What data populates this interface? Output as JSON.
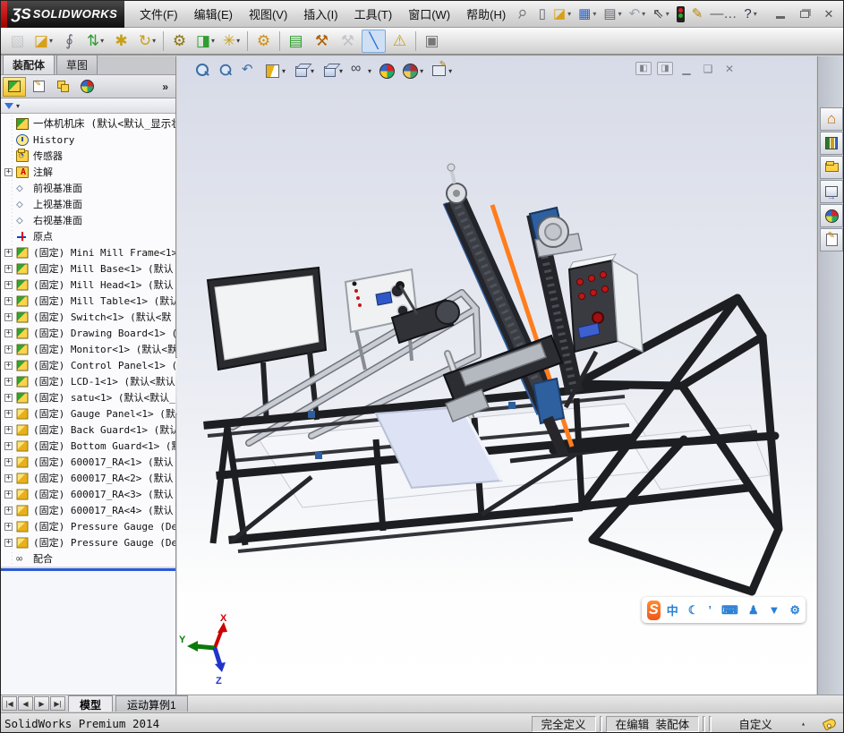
{
  "titlebar": {
    "logo_mark": "ƷS",
    "logo_text": "SOLIDWORKS",
    "menus": [
      {
        "label": "文件(F)"
      },
      {
        "label": "编辑(E)"
      },
      {
        "label": "视图(V)"
      },
      {
        "label": "插入(I)"
      },
      {
        "label": "工具(T)"
      },
      {
        "label": "窗口(W)"
      },
      {
        "label": "帮助(H)"
      }
    ],
    "quick_icons": [
      {
        "name": "new-document-button",
        "glyph": "▯",
        "color": "#5a6675"
      },
      {
        "name": "open-button",
        "glyph": "◪",
        "color": "#d8a01a",
        "caret": true
      },
      {
        "name": "save-button",
        "glyph": "▦",
        "color": "#2a62c8",
        "caret": true
      },
      {
        "name": "print-button",
        "glyph": "▤",
        "color": "#666670",
        "caret": true
      },
      {
        "name": "undo-button",
        "glyph": "↶",
        "color": "#9aa0aa",
        "caret": true
      },
      {
        "name": "select-button",
        "glyph": "⇖",
        "color": "#333",
        "caret": true
      },
      {
        "name": "rebuild-button",
        "glyph": "",
        "color": "#222"
      },
      {
        "name": "file-properties-button",
        "glyph": "✎",
        "color": "#b58400"
      },
      {
        "name": "options-button",
        "glyph": "—…",
        "color": "#555"
      },
      {
        "name": "help-button",
        "glyph": "?",
        "color": "#334",
        "caret": true
      }
    ]
  },
  "main_toolbar": {
    "items": [
      {
        "name": "insert-component-button",
        "glyph": "▧",
        "color": "#a7acb2",
        "disabled": true
      },
      {
        "name": "open-part-button",
        "glyph": "◪",
        "color": "#d8a01a",
        "caret": true
      },
      {
        "name": "mate-button",
        "glyph": "∮",
        "color": "#667"
      },
      {
        "name": "move-component-button",
        "glyph": "⇅",
        "color": "#2f9e2f",
        "caret": true
      },
      {
        "name": "smart-fasteners-button",
        "glyph": "✱",
        "color": "#c8a018"
      },
      {
        "name": "rotate-component-button",
        "glyph": "↻",
        "color": "#c8a018",
        "caret": true
      },
      {
        "name": "sep",
        "sep": true
      },
      {
        "name": "assembly-features-button",
        "glyph": "⚙",
        "color": "#8a7410"
      },
      {
        "name": "new-part-button",
        "glyph": "◨",
        "color": "#2f9e2f",
        "caret": true
      },
      {
        "name": "reference-geometry-button",
        "glyph": "✳",
        "color": "#c8a018",
        "caret": true
      },
      {
        "name": "sep",
        "sep": true
      },
      {
        "name": "motion-study-button",
        "glyph": "⚙",
        "color": "#d08f10"
      },
      {
        "name": "sep",
        "sep": true
      },
      {
        "name": "exploded-view-button",
        "glyph": "▤",
        "color": "#2f9e2f"
      },
      {
        "name": "interference-detection-button",
        "glyph": "⚒",
        "color": "#b06000"
      },
      {
        "name": "unavailable-tool-button",
        "glyph": "⚒",
        "color": "#99a",
        "disabled": true
      },
      {
        "name": "instant3d-button",
        "glyph": "╲",
        "color": "#2a6fd0",
        "selected": true
      },
      {
        "name": "large-assembly-mode-button",
        "glyph": "⚠",
        "color": "#c8a018"
      },
      {
        "name": "sep",
        "sep": true
      },
      {
        "name": "appearance-pattern-button",
        "glyph": "▣",
        "color": "#777"
      }
    ]
  },
  "left_panel": {
    "tabs": [
      {
        "label": "装配体",
        "active": true
      },
      {
        "label": "草图"
      }
    ],
    "pane_buttons": [
      {
        "name": "featuremanager-tree-tab",
        "icon": "cube",
        "active": true
      },
      {
        "name": "propertymanager-tab",
        "icon": "sheet"
      },
      {
        "name": "configurationmanager-tab",
        "icon": "cfg"
      },
      {
        "name": "appearances-tab",
        "icon": "ball"
      }
    ],
    "overflow_chevron": "»",
    "tree": [
      {
        "label": "一体机机床 (默认<默认_显示状",
        "icon": "assembly",
        "root": true
      },
      {
        "label": "History",
        "icon": "history"
      },
      {
        "label": "传感器",
        "icon": "sensors"
      },
      {
        "label": "注解",
        "icon": "annotations",
        "expand": true
      },
      {
        "label": "前视基准面",
        "icon": "plane"
      },
      {
        "label": "上视基准面",
        "icon": "plane"
      },
      {
        "label": "右视基准面",
        "icon": "plane"
      },
      {
        "label": "原点",
        "icon": "origin"
      },
      {
        "label": "(固定) Mini Mill Frame<1>",
        "icon": "part-green",
        "expand": true
      },
      {
        "label": "(固定) Mill Base<1> (默认",
        "icon": "part-green",
        "expand": true
      },
      {
        "label": "(固定) Mill Head<1> (默认",
        "icon": "part-green",
        "expand": true
      },
      {
        "label": "(固定) Mill Table<1> (默认",
        "icon": "part-green",
        "expand": true
      },
      {
        "label": "(固定) Switch<1> (默认<默",
        "icon": "part-green",
        "expand": true
      },
      {
        "label": "(固定) Drawing Board<1> (",
        "icon": "part-green",
        "expand": true
      },
      {
        "label": "(固定) Monitor<1> (默认<默",
        "icon": "part-green",
        "expand": true
      },
      {
        "label": "(固定) Control Panel<1> (",
        "icon": "part-green",
        "expand": true
      },
      {
        "label": "(固定) LCD-1<1> (默认<默认",
        "icon": "part-green",
        "expand": true
      },
      {
        "label": "(固定) satu<1> (默认<默认_",
        "icon": "part-green",
        "expand": true
      },
      {
        "label": "(固定) Gauge Panel<1> (默",
        "icon": "part-yellow",
        "expand": true
      },
      {
        "label": "(固定) Back Guard<1> (默认",
        "icon": "part-yellow",
        "expand": true
      },
      {
        "label": "(固定) Bottom Guard<1> (默",
        "icon": "part-yellow",
        "expand": true
      },
      {
        "label": "(固定) 600017_RA<1> (默认",
        "icon": "part-yellow",
        "expand": true
      },
      {
        "label": "(固定) 600017_RA<2> (默认",
        "icon": "part-yellow",
        "expand": true
      },
      {
        "label": "(固定) 600017_RA<3> (默认",
        "icon": "part-yellow",
        "expand": true
      },
      {
        "label": "(固定) 600017_RA<4> (默认",
        "icon": "part-yellow",
        "expand": true
      },
      {
        "label": "(固定) Pressure Gauge (Def",
        "icon": "part-yellow",
        "expand": true
      },
      {
        "label": "(固定) Pressure Gauge (Def",
        "icon": "part-yellow",
        "expand": true
      },
      {
        "label": "配合",
        "icon": "mates"
      }
    ]
  },
  "viewport": {
    "hud_icons": [
      {
        "name": "zoom-to-fit-icon"
      },
      {
        "name": "zoom-to-area-icon"
      },
      {
        "name": "previous-view-icon"
      },
      {
        "name": "section-view-icon",
        "caret": true
      },
      {
        "name": "view-orientation-icon",
        "caret": true
      },
      {
        "name": "display-style-icon",
        "caret": true
      },
      {
        "name": "hide-show-items-icon",
        "caret": true
      },
      {
        "name": "apply-scene-icon"
      },
      {
        "name": "view-settings-icon",
        "caret": true
      },
      {
        "name": "edit-appearance-icon",
        "caret": true
      }
    ],
    "window_buttons": [
      {
        "name": "pane-split-left-button",
        "glyph": "◧"
      },
      {
        "name": "pane-split-right-button",
        "glyph": "◨"
      },
      {
        "name": "child-minimize-button",
        "glyph": "▁",
        "plain": true
      },
      {
        "name": "child-restore-button",
        "glyph": "❑",
        "plain": true
      },
      {
        "name": "child-close-button",
        "glyph": "✕",
        "plain": true
      }
    ],
    "triad": {
      "x": "X",
      "y": "Y",
      "z": "Z"
    },
    "ime_bar": {
      "logo": "S",
      "icons": [
        {
          "name": "ime-chinese-mode-icon",
          "glyph": "中"
        },
        {
          "name": "ime-moon-fullhalf-icon",
          "glyph": "☾"
        },
        {
          "name": "ime-punctuation-icon",
          "glyph": "’"
        },
        {
          "name": "ime-soft-keyboard-icon",
          "glyph": "⌨"
        },
        {
          "name": "ime-user-icon",
          "glyph": "♟"
        },
        {
          "name": "ime-skin-icon",
          "glyph": "▼"
        },
        {
          "name": "ime-toolbox-icon",
          "glyph": "⚙"
        }
      ]
    }
  },
  "task_pane": {
    "icons": [
      {
        "name": "solidworks-resources-icon",
        "glyph": "⌂"
      },
      {
        "name": "design-library-icon"
      },
      {
        "name": "file-explorer-icon"
      },
      {
        "name": "view-palette-icon"
      },
      {
        "name": "appearances-scenes-icon",
        "ball": true
      },
      {
        "name": "custom-properties-icon"
      }
    ]
  },
  "bottom_tabs": {
    "nav": [
      {
        "name": "first-tab-button",
        "glyph": "|◀"
      },
      {
        "name": "prev-tab-button",
        "glyph": "◀"
      },
      {
        "name": "next-tab-button",
        "glyph": "▶"
      },
      {
        "name": "last-tab-button",
        "glyph": "▶|"
      }
    ],
    "tabs": [
      {
        "label": "模型",
        "active": true
      },
      {
        "label": "运动算例1"
      }
    ]
  },
  "status_bar": {
    "left_text": "SolidWorks Premium 2014",
    "define_state": "完全定义",
    "edit_state": "在编辑 装配体",
    "custom_label": "自定义"
  }
}
